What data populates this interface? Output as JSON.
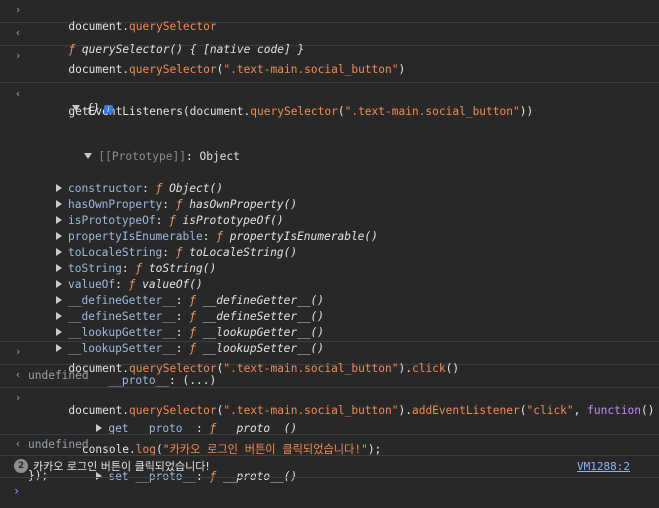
{
  "colors": {
    "background": "#282828",
    "divider": "#3d3d3d",
    "string": "#f28b54",
    "property": "#9bbbdc",
    "function_keyword": "#f29766",
    "link": "#8ab4f8",
    "call": "#c58af9"
  },
  "glyphs": {
    "input": "›",
    "output": "‹",
    "prompt": "›",
    "fn": "ƒ"
  },
  "entry1": {
    "p1": "document.",
    "p2": "querySelector"
  },
  "entry2": {
    "value": "querySelector() { [native code] }"
  },
  "entry3": {
    "l1p1": "document.",
    "l1p2": "querySelector",
    "l1p3": "(",
    "l1p4": "\".text-main.social_button\"",
    "l1p5": ")",
    "l2p1": "getEventListeners(document.",
    "l2p2": "querySelector",
    "l2p3": "(",
    "l2p4": "\".text-main.social_button\"",
    "l2p5": "))"
  },
  "entry4": {
    "root": "{}",
    "info": "i",
    "proto_label": "[[Prototype]]",
    "proto_value": ": Object",
    "members": [
      {
        "key": "constructor",
        "value": "Object()"
      },
      {
        "key": "hasOwnProperty",
        "value": "hasOwnProperty()"
      },
      {
        "key": "isPrototypeOf",
        "value": "isPrototypeOf()"
      },
      {
        "key": "propertyIsEnumerable",
        "value": "propertyIsEnumerable()"
      },
      {
        "key": "toLocaleString",
        "value": "toLocaleString()"
      },
      {
        "key": "toString",
        "value": "toString()"
      },
      {
        "key": "valueOf",
        "value": "valueOf()"
      },
      {
        "key": "__defineGetter__",
        "value": "__defineGetter__()"
      },
      {
        "key": "__defineSetter__",
        "value": "__defineSetter__()"
      },
      {
        "key": "__lookupGetter__",
        "value": "__lookupGetter__()"
      },
      {
        "key": "__lookupSetter__",
        "value": "__lookupSetter__()"
      }
    ],
    "proto_accessor": {
      "key": "__proto__",
      "value": ": (...)"
    },
    "getter": {
      "prefix": "get",
      "key": "__proto__",
      "value": "__proto__()"
    },
    "setter": {
      "prefix": "set",
      "key": "__proto__",
      "value": "__proto__()"
    }
  },
  "entry5": {
    "p1": "document.",
    "p2": "querySelector",
    "p3": "(",
    "p4": "\".text-main.social_button\"",
    "p5": ").",
    "p6": "click",
    "p7": "()"
  },
  "entry6": {
    "value": "undefined"
  },
  "entry7": {
    "l1p1": "document.",
    "l1p2": "querySelector",
    "l1p3": "(",
    "l1p4": "\".text-main.social_button\"",
    "l1p5": ").",
    "l1p6": "addEventListener",
    "l1p7": "(",
    "l1p8": "\"click\"",
    "l1p9": ", ",
    "l1p10": "function",
    "l1p11": "() {",
    "l2p1": "  console.",
    "l2p2": "log",
    "l2p3": "(",
    "l2p4": "\"카카오 로그인 버튼이 클릭되었습니다!\"",
    "l2p5": ");",
    "l3": "});"
  },
  "entry8": {
    "value": "undefined"
  },
  "entry9": {
    "count": "2",
    "message": "카카오 로그인 버튼이 클릭되었습니다!",
    "source": "VM1288:2"
  }
}
